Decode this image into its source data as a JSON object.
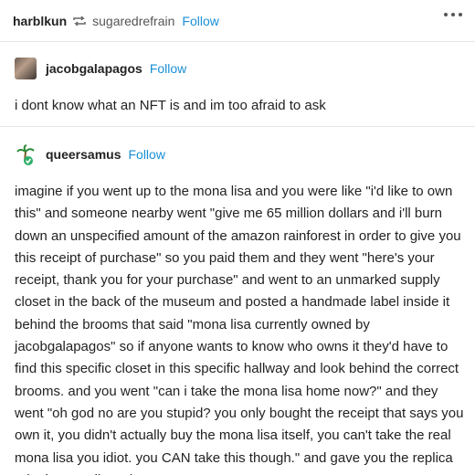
{
  "header": {
    "poster": "harblkun",
    "reblogged_from": "sugaredrefrain",
    "follow_label": "Follow"
  },
  "reblog1": {
    "username": "jacobgalapagos",
    "follow_label": "Follow",
    "text": "i dont know what an NFT is and im too afraid to ask"
  },
  "reblog2": {
    "username": "queersamus",
    "follow_label": "Follow",
    "text": "imagine if you went up to the mona lisa and you were like \"i'd like to own this\" and someone nearby went \"give me 65 million dollars and i'll burn down an unspecified amount of the amazon rainforest in order to give you this receipt of purchase\" so you paid them and they went \"here's your receipt, thank you for your purchase\" and went to an unmarked supply closet in the back of the museum and posted a handmade label inside it behind the brooms that said \"mona lisa currently owned by jacobgalapagos\" so if anyone wants to know who owns it they'd have to find this specific closet in this specific hallway and look behind the correct brooms. and you went \"can i take the mona lisa home now?\" and they went \"oh god no are you stupid? you only bought the receipt that says you own it, you didn't actually buy the mona lisa itself, you can't take the real mona lisa you idiot. you CAN take this though.\" and gave you the replica print in a cardboard"
  },
  "colors": {
    "accent": "#1a8fd6",
    "divider": "#e6e6e6"
  }
}
